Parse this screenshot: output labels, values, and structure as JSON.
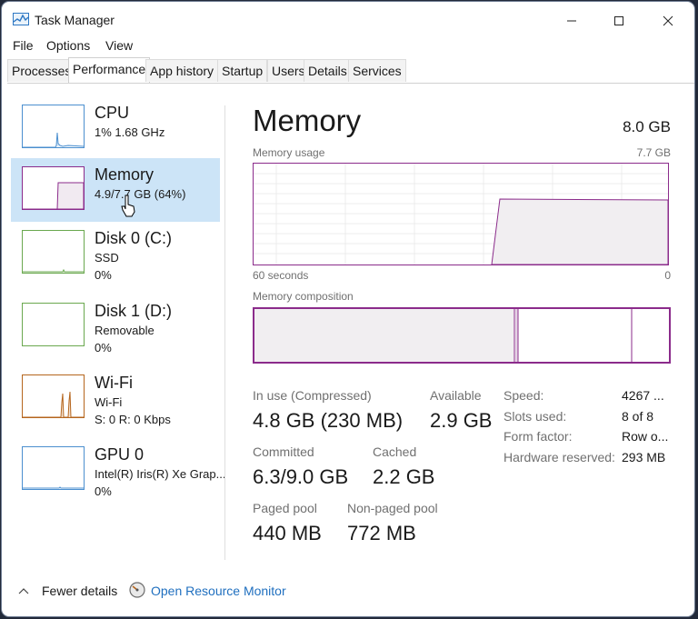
{
  "window": {
    "title": "Task Manager"
  },
  "menu": [
    "File",
    "Options",
    "View"
  ],
  "tabs": [
    "Processes",
    "Performance",
    "App history",
    "Startup",
    "Users",
    "Details",
    "Services"
  ],
  "active_tab": "Performance",
  "sidebar": [
    {
      "name": "CPU",
      "sub1": "1%  1.68 GHz",
      "sub2": ""
    },
    {
      "name": "Memory",
      "sub1": "4.9/7.7 GB (64%)",
      "sub2": ""
    },
    {
      "name": "Disk 0 (C:)",
      "sub1": "SSD",
      "sub2": "0%"
    },
    {
      "name": "Disk 1 (D:)",
      "sub1": "Removable",
      "sub2": "0%"
    },
    {
      "name": "Wi-Fi",
      "sub1": "Wi-Fi",
      "sub2": "S: 0  R: 0 Kbps"
    },
    {
      "name": "GPU 0",
      "sub1": "Intel(R) Iris(R) Xe Grap...",
      "sub2": "0%"
    }
  ],
  "main": {
    "title": "Memory",
    "total": "8.0 GB",
    "usage_label": "Memory usage",
    "usage_max": "7.7 GB",
    "axis_left": "60 seconds",
    "axis_right": "0",
    "composition_label": "Memory composition",
    "in_use_label": "In use (Compressed)",
    "in_use_value": "4.8 GB (230 MB)",
    "available_label": "Available",
    "available_value": "2.9 GB",
    "committed_label": "Committed",
    "committed_value": "6.3/9.0 GB",
    "cached_label": "Cached",
    "cached_value": "2.2 GB",
    "paged_label": "Paged pool",
    "paged_value": "440 MB",
    "nonpaged_label": "Non-paged pool",
    "nonpaged_value": "772 MB",
    "details": [
      {
        "label": "Speed:",
        "value": "4267 ..."
      },
      {
        "label": "Slots used:",
        "value": "8 of 8"
      },
      {
        "label": "Form factor:",
        "value": "Row o..."
      },
      {
        "label": "Hardware reserved:",
        "value": "293 MB"
      }
    ]
  },
  "footer": {
    "fewer_details": "Fewer details",
    "open_monitor": "Open Resource Monitor"
  },
  "colors": {
    "accent_blue": "#4b8fcf",
    "memory_purple": "#8b2b8b",
    "wifi_orange": "#b5651d",
    "selected_bg": "#cce4f7"
  }
}
